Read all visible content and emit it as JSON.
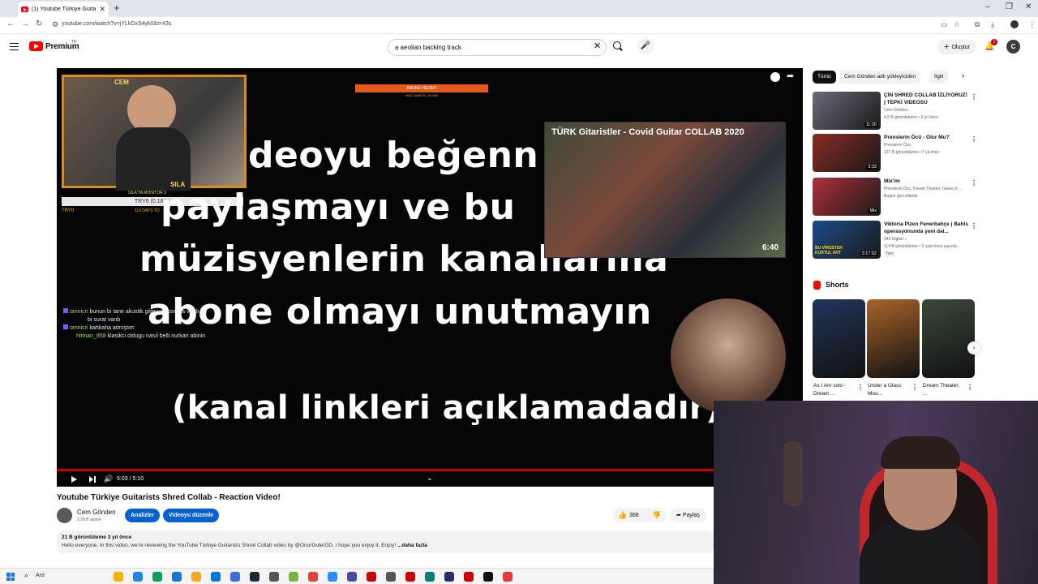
{
  "browser": {
    "tab_title": "(1) Youtube Türkiye Guitarists S",
    "tab_close": "✕",
    "new_tab": "+",
    "url": "youtube.com/watch?v=jYLkDxS4yk0&t=43s",
    "win_minimize": "–",
    "win_maximize": "❐",
    "win_close": "✕",
    "nav_back": "←",
    "nav_forward": "→",
    "nav_reload": "↻"
  },
  "header": {
    "logo_text": "Premium",
    "logo_sup": "TR",
    "search_value": "a aeolian backing track",
    "search_clear": "✕",
    "mic_glyph": "🎤",
    "create_label": "Oluştur",
    "create_plus": "+",
    "notification_count": "1",
    "account_initial": "C"
  },
  "player": {
    "overlay_cem": "CEM",
    "overlay_sila": "SILA",
    "overlay_sila_monitor": "SILA'YA MONITOR 3",
    "overlay_tryx": "TRY6 (0.16%)",
    "overlay_tryo": "TRY0",
    "overlay_days": "119 DAYS TO",
    "overlay_abone": "ABONE HEDEFİ",
    "overlay_abone_bar": "ABONE HEDEFİ",
    "overlay_abone_sub": "HAZ. DAVETLİ 40.000",
    "caption_lines": [
      "deoyu beğenn",
      "paylaşmayı ve bu",
      "müzisyenlerin kanallarına",
      "abone olmayı unutmayın",
      "(kanal linkleri açıklamadadır)"
    ],
    "card_title": "TÜRK Gitaristler - Covid Guitar COLLAB 2020",
    "card_duration": "6:40",
    "chat": [
      {
        "nick": "omnicri",
        "text": "bunun bi tane akustik gitar videosu da vardı"
      },
      {
        "nick": "",
        "text": "bi surat vardı"
      },
      {
        "nick": "omnicri",
        "text": "kahkaha atmıştım"
      },
      {
        "nick": "hitman_858",
        "text": "klasikci oldugu nasıl belli nurkan abinin"
      }
    ],
    "time": "5:03 / 5:10",
    "chevron": "⌄",
    "volume_glyph": "🔊",
    "share_glyph": "➦"
  },
  "video": {
    "title": "Youtube Türkiye Guitarists Shred Collab - Reaction Video!",
    "channel_name": "Cem Gönden",
    "channel_subs": "3,78 B abone",
    "analytics_label": "Analizler",
    "edit_label": "Videoyu düzenle",
    "like_glyph": "👍",
    "like_count": "368",
    "dislike_glyph": "👎",
    "share_label": "Paylaş",
    "share_glyph": "➦",
    "desc_meta": "21 B görüntüleme  3 yıl önce",
    "desc_text": "Hello everyone. In this video, we're reviewing the YouTube Türkiye Guitarists Shred Collab video by @OnurGulerGD. I hope you enjoy it. Enjoy! ",
    "desc_more": "...daha fazla"
  },
  "sidebar": {
    "chips": [
      "Tümü",
      "Cem Gönden adlı yükleyiciden",
      "İlgili"
    ],
    "chips_next": "›",
    "recommendations": [
      {
        "title": "ÇİN SHRED COLLAB İZLİYORUZ! | TEPKİ VIDEOSU",
        "channel": "Cem Gönden",
        "meta": "4,5 B görüntüleme • 3 yıl önce",
        "duration": "11:20",
        "color": "#6a6a7a"
      },
      {
        "title": "Prenslerin Öcü - Olur Mu?",
        "channel": "Prenslerin Öcü",
        "meta": "127 B görüntüleme • 7 yıl önce",
        "duration": "3:33",
        "color": "#8a2a22"
      },
      {
        "title": "Mix'im",
        "channel": "Prenslerin Öcü, Dream Theater, Gates of ...",
        "meta": "Bugün güncellendi",
        "duration": "Mix",
        "color": "#b0303a"
      },
      {
        "title": "Viktoria Plzen Fenerbahçe | Bahis operasyonunda yeni dal...",
        "channel": "343 Digital ✓",
        "meta": "114 B görüntüleme • 9 saat önce yayınla...",
        "badge": "Yeni",
        "duration": "3:17:02",
        "thumb_text": "BU VİRÜSTEN KURTUL ART",
        "color": "#1d4a8a"
      }
    ],
    "kebab": "⋮",
    "shorts_title": "Shorts",
    "shorts": [
      {
        "title": "As I Am solo - Dream ...",
        "color": "#22355a"
      },
      {
        "title": "Under a Glass Moo...",
        "color": "#a8642a"
      },
      {
        "title": "Dream Theater, ...",
        "color": "#3a4a3a"
      }
    ],
    "shorts_next": "›"
  },
  "taskbar": {
    "search_glyph": "⌕",
    "search_label": "Ara",
    "apps": [
      "#f2b400",
      "#1e88e5",
      "#0f9d58",
      "#1976d2",
      "#f5a623",
      "#0078d4",
      "#3d6fd8",
      "#1b2838",
      "#555555",
      "#7cb342",
      "#db4437",
      "#2d8cff",
      "#4a4aa0",
      "#cc0000",
      "#555555",
      "#cc0000",
      "#0a7e6f",
      "#2b2b6a",
      "#cc0000",
      "#111111",
      "#e53935"
    ]
  }
}
